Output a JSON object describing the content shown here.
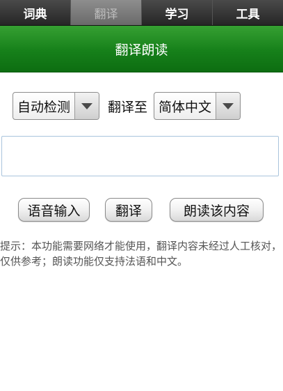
{
  "tabs": [
    {
      "label": "词典",
      "active": false
    },
    {
      "label": "翻译",
      "active": true
    },
    {
      "label": "学习",
      "active": false
    },
    {
      "label": "工具",
      "active": false
    }
  ],
  "header": {
    "title": "翻译朗读"
  },
  "language": {
    "source_value": "自动检测",
    "to_label": "翻译至",
    "target_value": "简体中文",
    "arrow_icon": "chevron-down-icon"
  },
  "input": {
    "value": "",
    "placeholder": ""
  },
  "buttons": {
    "voice_input": "语音输入",
    "translate": "翻译",
    "read_content": "朗读该内容"
  },
  "hint": {
    "text": "提示：本功能需要网络才能使用，翻译内容未经过人工核对，仅供参考；朗读功能仅支持法语和中文。"
  },
  "colors": {
    "header_green": "#16801a",
    "tabbar_dark": "#262626",
    "active_tab": "#7a7a7a"
  }
}
